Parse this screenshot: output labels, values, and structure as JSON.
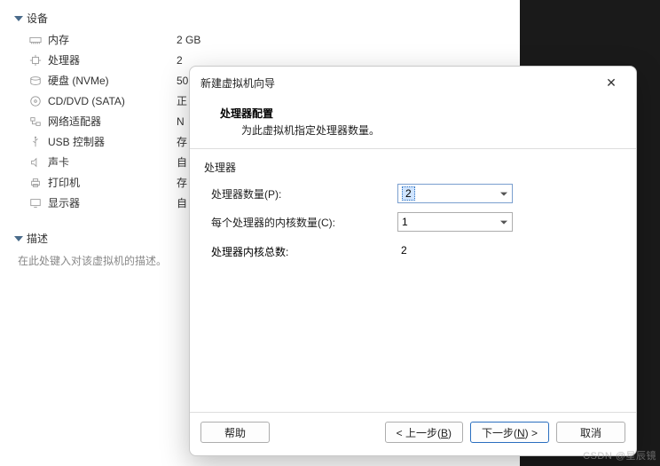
{
  "sections": {
    "devices_title": "设备",
    "desc_title": "描述",
    "desc_placeholder": "在此处键入对该虚拟机的描述。"
  },
  "devices": [
    {
      "label": "内存",
      "value": "2 GB"
    },
    {
      "label": "处理器",
      "value": "2"
    },
    {
      "label": "硬盘 (NVMe)",
      "value": "50"
    },
    {
      "label": "CD/DVD (SATA)",
      "value": "正"
    },
    {
      "label": "网络适配器",
      "value": "N"
    },
    {
      "label": "USB 控制器",
      "value": "存"
    },
    {
      "label": "声卡",
      "value": "自"
    },
    {
      "label": "打印机",
      "value": "存"
    },
    {
      "label": "显示器",
      "value": "自"
    }
  ],
  "dialog": {
    "window_title": "新建虚拟机向导",
    "heading": "处理器配置",
    "sub": "为此虚拟机指定处理器数量。",
    "group": "处理器",
    "proc_count_label": "处理器数量(P):",
    "cores_label": "每个处理器的内核数量(C):",
    "total_label": "处理器内核总数:",
    "proc_count_value": "2",
    "cores_value": "1",
    "total_value": "2",
    "buttons": {
      "help": "帮助",
      "back_pre": "< 上一步(",
      "back_key": "B",
      "back_post": ")",
      "next_pre": "下一步(",
      "next_key": "N",
      "next_post": ") >",
      "cancel": "取消"
    }
  },
  "watermark": "CSDN @星辰镜"
}
